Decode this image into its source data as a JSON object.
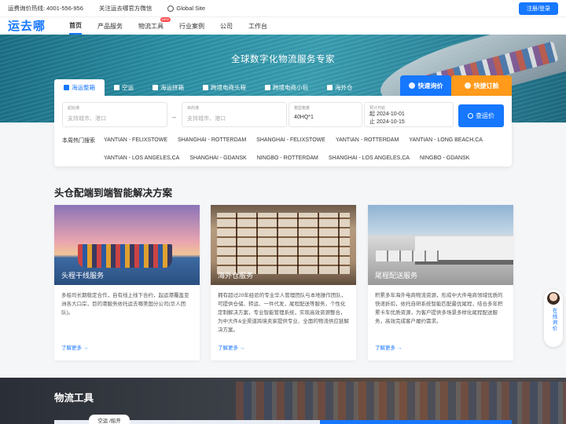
{
  "topbar": {
    "hotline": "运费询价热线: 4001-556-956",
    "wechat": "关注运去哪官方微信",
    "global_site": "Global Site",
    "login": "注册/登录"
  },
  "nav": {
    "logo": "运去哪",
    "items": [
      "首页",
      "产品服务",
      "物流工具",
      "行业案例",
      "公司",
      "工作台"
    ],
    "new_badge": "NEW"
  },
  "hero": {
    "title": "全球数字化物流服务专家"
  },
  "search": {
    "tabs": [
      "海运整箱",
      "空运",
      "海运拼箱",
      "跨境电商头程",
      "跨境电商小包",
      "海外仓"
    ],
    "quick_inquiry": "快速询价",
    "quick_booking": "快捷订舱",
    "origin_label": "起始港",
    "origin_placeholder": "支持城市、港口",
    "dest_label": "目的港",
    "dest_placeholder": "支持城市、港口",
    "container_label": "箱型箱量",
    "container_value": "40HQ*1",
    "date_label": "预计开航",
    "date_from": "起 2024-10-01",
    "date_to": "止 2024-10-15",
    "arrow": "→",
    "search_button": "查运价",
    "hot_routes_label": "本周热门搜索",
    "hot_routes": [
      "YANTIAN - FELIXSTOWE",
      "SHANGHAI - ROTTERDAM",
      "SHANGHAI - FELIXSTOWE",
      "YANTIAN - ROTTERDAM",
      "YANTIAN - LONG BEACH,CA",
      "YANTIAN - LOS ANGELES,CA",
      "SHANGHAI - GDANSK",
      "NINGBO - ROTTERDAM",
      "SHANGHAI - LOS ANGELES,CA",
      "NINGBO - GDANSK"
    ]
  },
  "solutions": {
    "title": "头仓配端到端智能解决方案",
    "cards": [
      {
        "caption": "头程干线服务",
        "text": "多船司长期稳定合作，自有线上线下合约，起运港覆盖亚洲各大口岸，目的港服务依托运去哪美国分公司(华人团队)。",
        "more": "了解更多 →"
      },
      {
        "caption": "海外仓服务",
        "text": "拥有超过20年经验的专业华人管理团队与本地操作团队，可提供仓储、转运、一件代发，尾程配送等服务，个性化定制解决方案，专业智能管理系统，实现高效资源整合，为中大件&全渠道跨境卖家提供专业、全面的物流供应链解决方案。",
        "more": "了解更多 →"
      },
      {
        "caption": "尾程配送服务",
        "text": "积累多年海外电商物流资源，形成中大件电商领域优质的快递折扣，依托自研系统智能匹配最优尾程，结合多年积累卡车优质资源，为客户提供多场景多样化尾程配送服务，高效完成客户履约需求。",
        "more": "了解更多 →"
      }
    ]
  },
  "tools": {
    "title": "物流工具",
    "tab": "空运 /船开"
  },
  "float": {
    "label": "在线询价"
  },
  "colors": {
    "brand": "#1677ff",
    "orange": "#ff9a1a"
  }
}
